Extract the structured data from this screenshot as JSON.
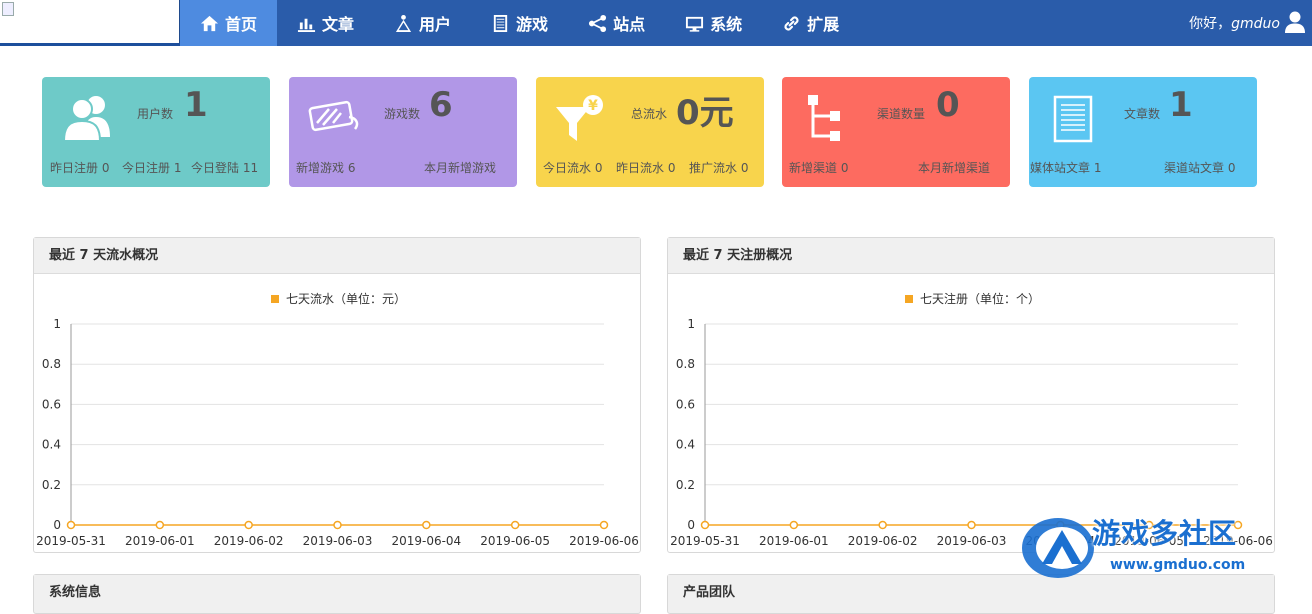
{
  "nav": {
    "items": [
      {
        "label": "首页",
        "icon": "home-icon",
        "active": true
      },
      {
        "label": "文章",
        "icon": "bar-chart-icon",
        "active": false
      },
      {
        "label": "用户",
        "icon": "user-triangle-icon",
        "active": false
      },
      {
        "label": "游戏",
        "icon": "list-icon",
        "active": false
      },
      {
        "label": "站点",
        "icon": "share-nodes-icon",
        "active": false
      },
      {
        "label": "系统",
        "icon": "monitor-icon",
        "active": false
      },
      {
        "label": "扩展",
        "icon": "link-icon",
        "active": false
      }
    ],
    "greeting": "你好，",
    "username": "gmduo"
  },
  "cards": [
    {
      "label": "用户数",
      "value": "1",
      "color": "#6ecac8",
      "icon": "users-icon",
      "subs": [
        "昨日注册 0",
        "今日注册 1",
        "今日登陆 11"
      ]
    },
    {
      "label": "游戏数",
      "value": "6",
      "color": "#b197e7",
      "icon": "game-card-icon",
      "subs": [
        "新增游戏 6",
        "本月新增游戏"
      ]
    },
    {
      "label": "总流水",
      "value": "0元",
      "color": "#f8d44c",
      "icon": "funnel-yen-icon",
      "subs": [
        "今日流水 0",
        "昨日流水 0",
        "推广流水 0"
      ]
    },
    {
      "label": "渠道数量",
      "value": "0",
      "color": "#fd6b60",
      "icon": "sitemap-icon",
      "subs": [
        "新增渠道 0",
        "本月新增渠道"
      ]
    },
    {
      "label": "文章数",
      "value": "1",
      "color": "#5bc6f2",
      "icon": "document-icon",
      "subs": [
        "媒体站文章 1",
        "渠道站文章 0"
      ]
    }
  ],
  "panels": {
    "flow": {
      "title": "最近 7 天流水概况"
    },
    "register": {
      "title": "最近 7 天注册概况"
    },
    "system": {
      "title": "系统信息"
    },
    "team": {
      "title": "产品团队"
    }
  },
  "chart_data": [
    {
      "type": "line",
      "title": "",
      "x": [
        "2019-05-31",
        "2019-06-01",
        "2019-06-02",
        "2019-06-03",
        "2019-06-04",
        "2019-06-05",
        "2019-06-06"
      ],
      "series": [
        {
          "name": "七天流水（单位：元）",
          "values": [
            0,
            0,
            0,
            0,
            0,
            0,
            0
          ],
          "color": "#f5a623"
        }
      ],
      "yticks": [
        "0",
        "0.2",
        "0.4",
        "0.6",
        "0.8",
        "1"
      ],
      "ylim": [
        0,
        1
      ],
      "legend": "top-center",
      "grid": true
    },
    {
      "type": "line",
      "title": "",
      "x": [
        "2019-05-31",
        "2019-06-01",
        "2019-06-02",
        "2019-06-03",
        "2019-06-04",
        "2019-06-05",
        "2019-06-06"
      ],
      "series": [
        {
          "name": "七天注册（单位：个）",
          "values": [
            0,
            0,
            0,
            0,
            0,
            0,
            0
          ],
          "color": "#f5a623"
        }
      ],
      "yticks": [
        "0",
        "0.2",
        "0.4",
        "0.6",
        "0.8",
        "1"
      ],
      "ylim": [
        0,
        1
      ],
      "legend": "top-center",
      "grid": true
    }
  ],
  "watermark": {
    "text": "游戏多社区",
    "url": "www.gmduo.com"
  }
}
